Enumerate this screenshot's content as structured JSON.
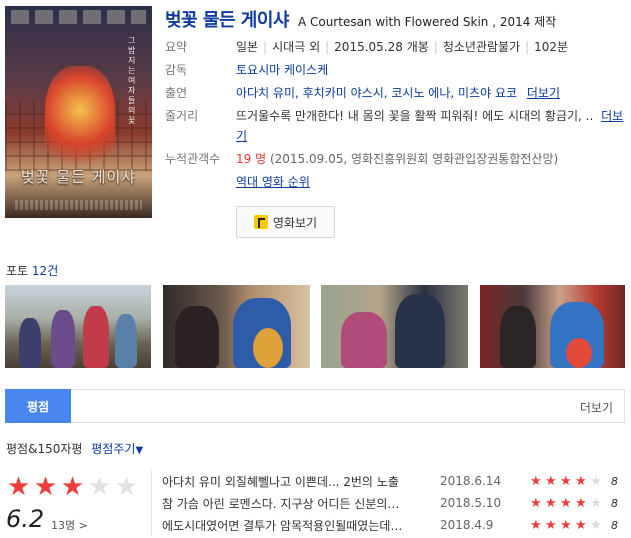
{
  "movie": {
    "title_ko": "벚꽃 물든 게이샤",
    "title_en": "A Courtesan with Flowered Skin , 2014 제작",
    "poster_title": "벚꽃 물든 게이샤",
    "poster_tagline": "그 밤 지는 여자들의 꽃"
  },
  "info": {
    "overview_label": "요약",
    "overview": [
      "일본",
      "시대극 외",
      "2015.05.28 개봉",
      "청소년관람불가",
      "102분"
    ],
    "director_label": "감독",
    "director": "토요시마 케이스케",
    "cast_label": "출연",
    "cast": "아다치 유미, 후치카미 야스시, 코시노 에나, 미츠야 요코",
    "cast_more": "더보기",
    "story_label": "줄거리",
    "story": "뜨거울수록 만개한다! 내 몸의 꽃을 활짝 피워줘! 에도 시대의 황금기, ..",
    "story_more": "더보기",
    "audience_label": "누적관객수",
    "audience_count": "19 명",
    "audience_note": "(2015.09.05, 영화진흥위원회 영화관입장권통합전산망)",
    "ranking_link": "역대 영화 순위",
    "watch_button": "영화보기"
  },
  "photos": {
    "label": "포토",
    "count": "12건"
  },
  "tabs": {
    "active": "평점",
    "more": "더보기"
  },
  "rating": {
    "head": "평점&150자평",
    "action": "평점주기",
    "score": "6.2",
    "count": "13명 >",
    "stars_filled": 3,
    "stars_total": 5
  },
  "reviews": [
    {
      "text": "아다치 유미 외질혜뻴나고 이쁜데... 2번의 노출",
      "date": "2018.6.14",
      "stars": 4,
      "score": "8"
    },
    {
      "text": "참 가슴 아린 로멘스다. 지구상 어디든 신분의…",
      "date": "2018.5.10",
      "stars": 4,
      "score": "8"
    },
    {
      "text": "에도시대였어면 결투가 암목적용인될때였는데…",
      "date": "2018.4.9",
      "stars": 4,
      "score": "8"
    }
  ],
  "colors": {
    "accent_blue": "#0c3b9d",
    "tab_blue": "#4a86f0",
    "star_red": "#ee3b3b"
  }
}
